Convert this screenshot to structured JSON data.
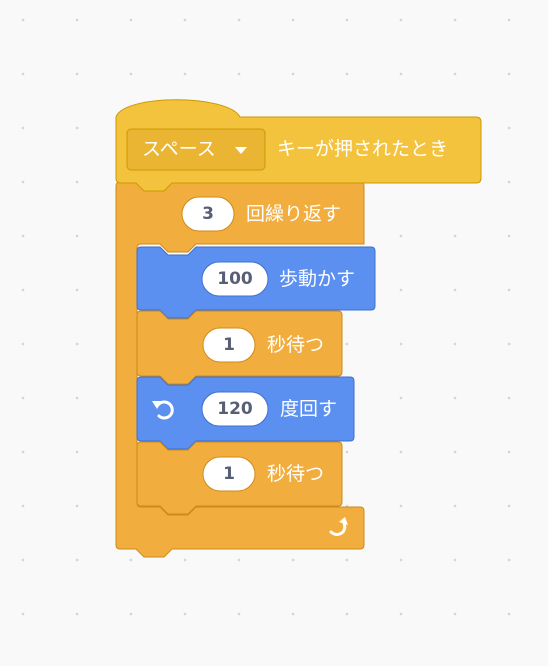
{
  "colors": {
    "events": "#ffbf00",
    "events_light": "#f4c33d",
    "events_border": "#cc9900",
    "control": "#f2ad3f",
    "control_border": "#cf8b17",
    "motion": "#5b8ff0",
    "motion_border": "#3f70cc",
    "input_text": "#575e75"
  },
  "hat": {
    "key_dropdown": "スペース",
    "label": "キーが押されたとき"
  },
  "repeat": {
    "count": "3",
    "label": "回繰り返す"
  },
  "move": {
    "steps": "100",
    "label": "歩動かす"
  },
  "wait1": {
    "seconds": "1",
    "label": "秒待つ"
  },
  "turn": {
    "degrees": "120",
    "label": "度回す",
    "icon": "rotate-left-icon"
  },
  "wait2": {
    "seconds": "1",
    "label": "秒待つ"
  },
  "loop_arrow_icon": "loop-arrow-icon"
}
